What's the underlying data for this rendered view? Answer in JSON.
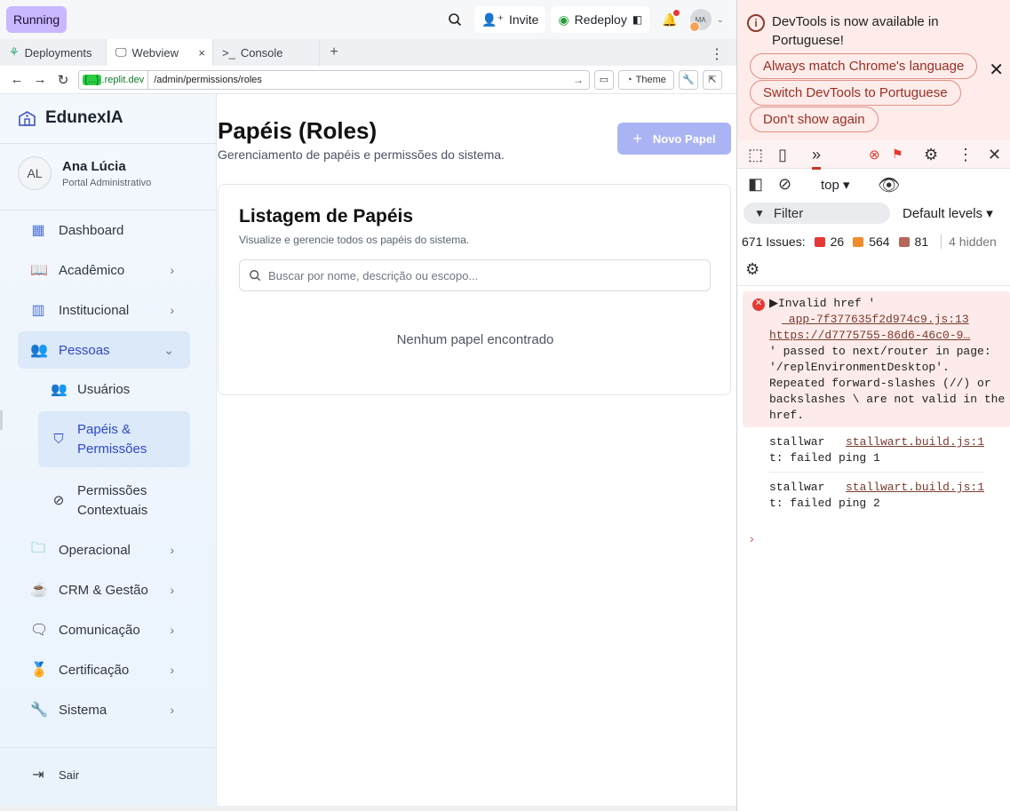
{
  "topbar": {
    "running_label": "Running",
    "invite_label": "Invite",
    "redeploy_label": "Redeploy",
    "avatar_initials": "MA"
  },
  "tabs": [
    {
      "label": "Deployments"
    },
    {
      "label": "Webview"
    },
    {
      "label": "Console"
    }
  ],
  "urlbar": {
    "domain_brace": "{...}",
    "domain": ".replit.dev",
    "path": "/admin/permissions/roles",
    "theme_label": "Theme"
  },
  "sidebar": {
    "brand": "EdunexIA",
    "user_initials": "AL",
    "user_name": "Ana Lúcia",
    "user_role": "Portal Administrativo",
    "items": [
      {
        "label": "Dashboard"
      },
      {
        "label": "Acadêmico"
      },
      {
        "label": "Institucional"
      },
      {
        "label": "Pessoas"
      },
      {
        "label": "Operacional"
      },
      {
        "label": "CRM & Gestão"
      },
      {
        "label": "Comunicação"
      },
      {
        "label": "Certificação"
      },
      {
        "label": "Sistema"
      }
    ],
    "sub_items": [
      {
        "label": "Usuários"
      },
      {
        "label": "Papéis & Permissões"
      },
      {
        "label": "Permissões Contextuais"
      }
    ],
    "logout_label": "Sair"
  },
  "main": {
    "title": "Papéis (Roles)",
    "subtitle": "Gerenciamento de papéis e permissões do sistema.",
    "new_button": "Novo Papel",
    "card_title": "Listagem de Papéis",
    "card_subtitle": "Visualize e gerencie todos os papéis do sistema.",
    "search_placeholder": "Buscar por nome, descrição ou escopo...",
    "empty_message": "Nenhum papel encontrado"
  },
  "devtools": {
    "notice_text": "DevTools is now available in Portuguese!",
    "pill_match": "Always match Chrome's language",
    "pill_switch": "Switch DevTools to Portuguese",
    "pill_dont": "Don't show again",
    "context": "top",
    "filter_label": "Filter",
    "levels_label": "Default levels",
    "issues_label": "671 Issues:",
    "issues_errors": "26",
    "issues_warnings": "564",
    "issues_info": "81",
    "hidden_label": "4 hidden",
    "error_msg_pre": "Invalid href '",
    "error_link1": "_app-7f377635f2d974c9.js:13",
    "error_link2": "https://d7775755-86d6-46c0-9…",
    "error_msg_post": "' passed to next/router in page: '/replEnvironmentDesktop'. Repeated forward-slashes (//) or backslashes \\ are not valid in the href.",
    "log1_prefix": "stallwar",
    "log1_link": "stallwart.build.js:1",
    "log1_text": "t: failed ping 1",
    "log2_prefix": "stallwar",
    "log2_link": "stallwart.build.js:1",
    "log2_text": "t: failed ping 2"
  },
  "colors": {
    "accent": "#2f49c9",
    "running_bg": "#c9b8ff",
    "new_button_bg": "#aab4f5",
    "devtools_notice_bg": "#fdecea"
  }
}
